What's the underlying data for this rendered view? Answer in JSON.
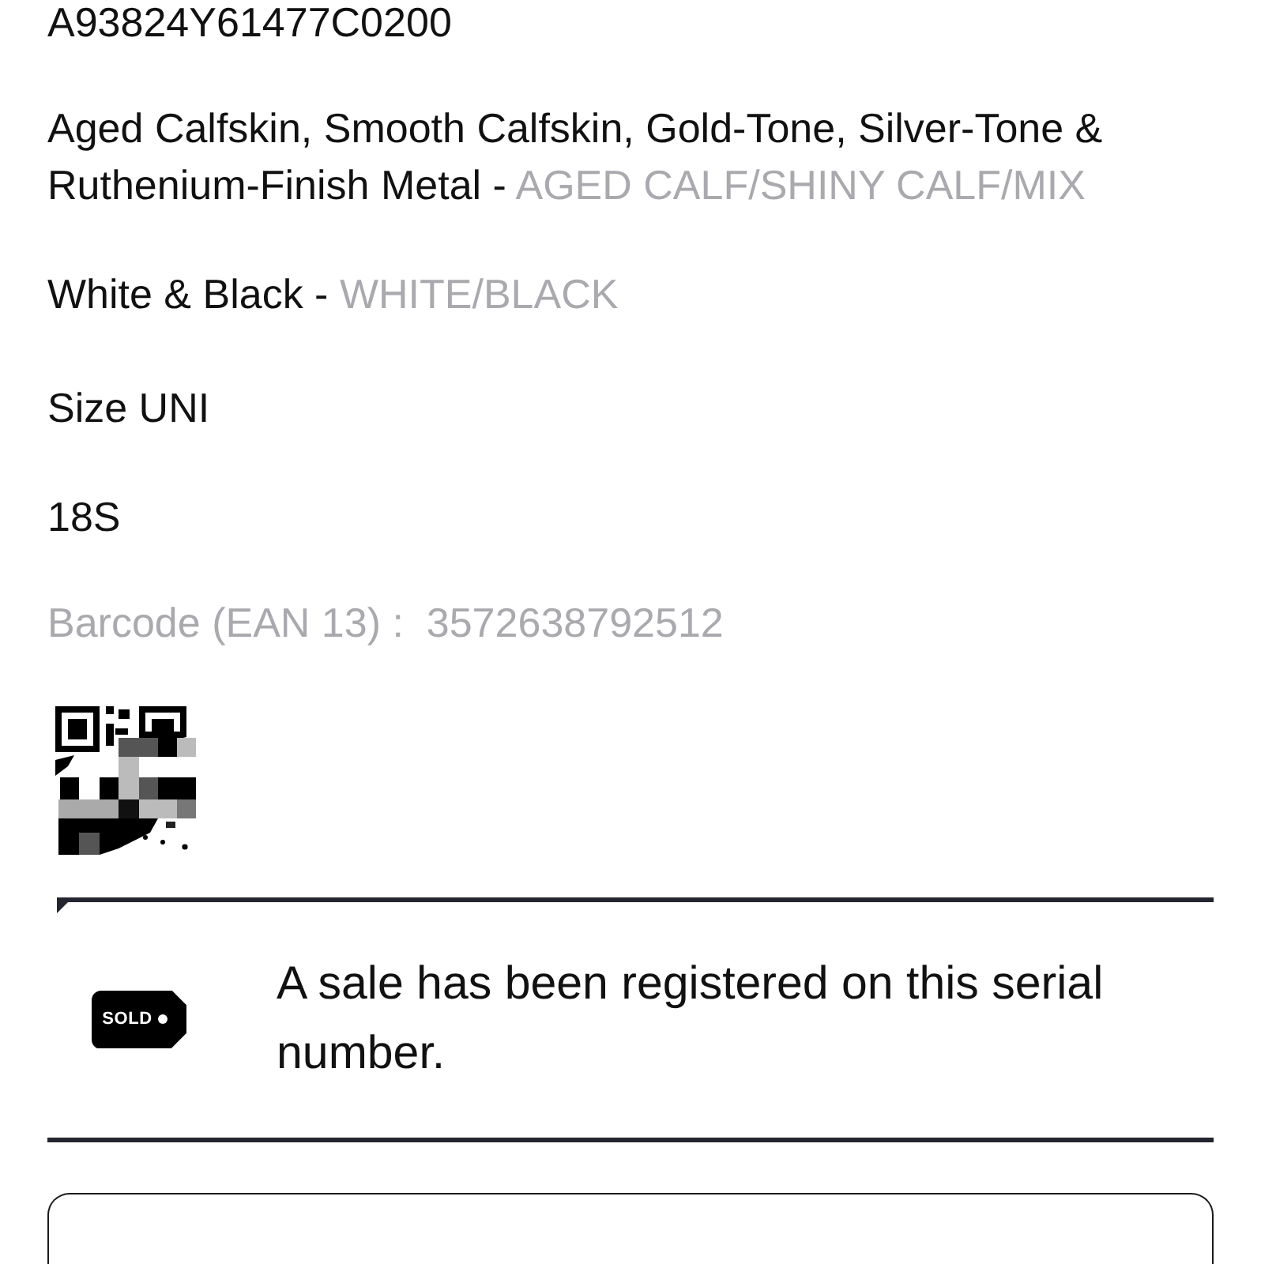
{
  "product": {
    "reference": "A93824Y61477C0200",
    "materials": {
      "name": "Aged Calfskin, Smooth Calfskin, Gold-Tone, Silver-Tone & Ruthenium-Finish Metal -",
      "code": "AGED CALF/SHINY CALF/MIX"
    },
    "colorway": {
      "name": "White & Black -",
      "code": "WHITE/BLACK"
    },
    "size": "Size UNI",
    "season": "18S",
    "barcode": {
      "label": "Barcode (EAN 13) :",
      "value": "3572638792512"
    }
  },
  "sale_notice": {
    "tag_label": "SOLD",
    "message": "A sale has been registered on this serial number."
  }
}
